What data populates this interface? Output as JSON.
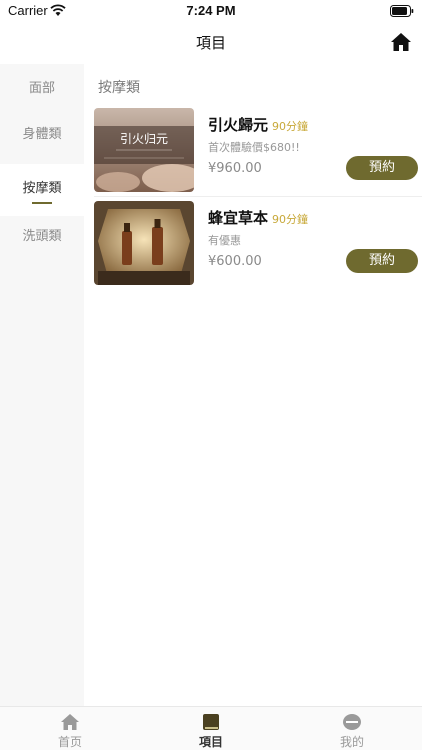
{
  "status_bar": {
    "carrier": "Carrier",
    "time": "7:24 PM"
  },
  "header": {
    "title": "項目",
    "home_icon": "home-icon"
  },
  "sidebar": {
    "items": [
      {
        "label": "面部"
      },
      {
        "label": "身體類"
      },
      {
        "label": "按摩類",
        "active": true
      },
      {
        "label": "洗頭類"
      }
    ]
  },
  "main": {
    "section_title": "按摩類",
    "cards": [
      {
        "name": "引火歸元",
        "duration": "90分鐘",
        "desc": "首次體驗價$680!!",
        "price": "¥960.00",
        "book_label": "預約",
        "image_text": "引火归元"
      },
      {
        "name": "蜂宜草本",
        "duration": "90分鐘",
        "desc": "有優惠",
        "price": "¥600.00",
        "book_label": "預約"
      }
    ]
  },
  "tabbar": {
    "items": [
      {
        "label": "首页",
        "icon": "home-icon"
      },
      {
        "label": "項目",
        "icon": "book-icon",
        "active": true
      },
      {
        "label": "我的",
        "icon": "profile-icon"
      }
    ]
  },
  "colors": {
    "accent": "#6f6a2f",
    "duration": "#c8a93a",
    "sidebar_bg": "#f7f7f7"
  }
}
